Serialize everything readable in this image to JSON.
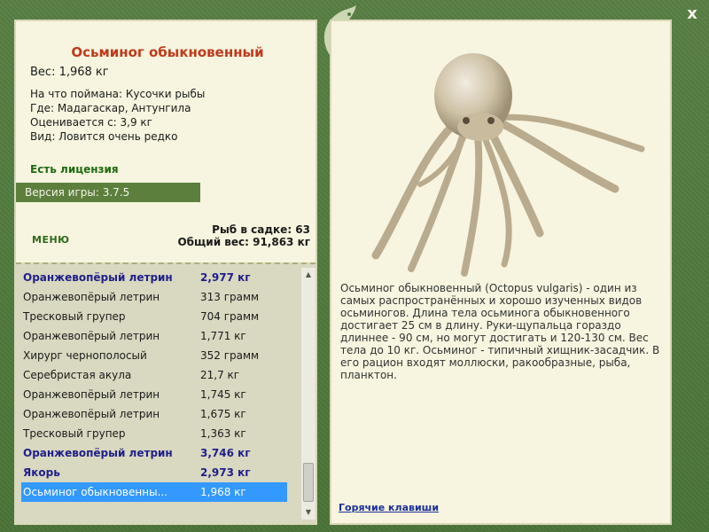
{
  "window": {
    "close_label": "x"
  },
  "fish": {
    "title": "Осьминог обыкновенный",
    "weight": "Вес: 1,968 кг",
    "bait": "На что поймана: Кусочки рыбы",
    "location": "Где: Мадагаскар, Антунгила",
    "rated_from": "Оценивается с: 3,9 кг",
    "rarity": "Вид: Ловится очень редко"
  },
  "license_text": "Есть лицензия",
  "version_text": "Версия игры: 3.7.5",
  "menu_label": "МЕНЮ",
  "keep": {
    "count_text": "Рыб в садке: 63",
    "total_text": "Общий вес: 91,863 кг"
  },
  "catch_list": [
    {
      "name": "Оранжевопёрый летрин",
      "weight": "2,977 кг",
      "bold": true
    },
    {
      "name": "Оранжевопёрый летрин",
      "weight": "313 грамм",
      "bold": false
    },
    {
      "name": "Тресковый групер",
      "weight": "704 грамм",
      "bold": false
    },
    {
      "name": "Оранжевопёрый летрин",
      "weight": "1,771 кг",
      "bold": false
    },
    {
      "name": "Хирург чернополосый",
      "weight": "352 грамм",
      "bold": false
    },
    {
      "name": "Серебристая акула",
      "weight": "21,7 кг",
      "bold": false
    },
    {
      "name": "Оранжевопёрый летрин",
      "weight": "1,745 кг",
      "bold": false
    },
    {
      "name": "Оранжевопёрый летрин",
      "weight": "1,675 кг",
      "bold": false
    },
    {
      "name": "Тресковый групер",
      "weight": "1,363 кг",
      "bold": false
    },
    {
      "name": "Оранжевопёрый летрин",
      "weight": "3,746 кг",
      "bold": true
    },
    {
      "name": "Якорь",
      "weight": "2,973 кг",
      "bold": true
    },
    {
      "name": "Осьминог обыкновенны...",
      "weight": "1,968 кг",
      "bold": false,
      "selected": true
    }
  ],
  "description": "Осьминог обыкновенный (Octopus vulgaris) - один из самых распространённых и хорошо изученных видов осьминогов. Длина тела осьминога обыкновенного достигает 25 см в длину. Руки-щупальца гораздо длиннее - 90 см, но могут достигать и 120-130 см. Вес тела до 10 кг. Осьминог - типичный хищник-засадчик. В его рацион входят моллюски, ракообразные, рыба, планктон.",
  "hotkeys_label": "Горячие клавиши",
  "colors": {
    "frame": "#4f7a3c",
    "panel": "#f7f5df",
    "title_red": "#c0391b",
    "license_green": "#1f6a12",
    "bold_blue": "#1f1f8a",
    "selected_blue": "#3399ff"
  },
  "icons": {
    "logo": "fish-logo-icon",
    "close": "close-icon",
    "scroll_up": "chevron-up-icon",
    "scroll_down": "chevron-down-icon"
  }
}
